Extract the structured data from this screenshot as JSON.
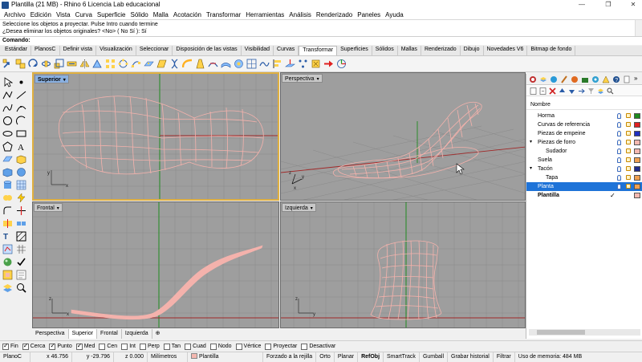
{
  "window": {
    "title": "Plantilla (21 MB) - Rhino 6 Licencia Lab educacional",
    "controls": [
      "—",
      "❐",
      "✕"
    ]
  },
  "menu": [
    "Archivo",
    "Edición",
    "Vista",
    "Curva",
    "Superficie",
    "Sólido",
    "Malla",
    "Acotación",
    "Transformar",
    "Herramientas",
    "Análisis",
    "Renderizado",
    "Paneles",
    "Ayuda"
  ],
  "command_history": [
    "Seleccione los objetos a proyectar. Pulse Intro cuando termine",
    "¿Desea eliminar los objetos originales? <No> ( No  Sí ): Sí"
  ],
  "command_prompt": "Comando:",
  "toolbar_tabs": [
    "Estándar",
    "PlanosC",
    "Definir vista",
    "Visualización",
    "Seleccionar",
    "Disposición de las vistas",
    "Visibilidad",
    "Curvas",
    "Transformar",
    "Superficies",
    "Sólidos",
    "Mallas",
    "Renderizado",
    "Dibujo",
    "Novedades V6",
    "Bitmap de fondo"
  ],
  "active_toolbar_tab": "Transformar",
  "viewports": {
    "top": {
      "label": "Superior",
      "active": true
    },
    "perspective": {
      "label": "Perspectiva",
      "active": false
    },
    "front": {
      "label": "Frontal",
      "active": false
    },
    "right": {
      "label": "Izquierda",
      "active": false
    }
  },
  "viewport_tabs": [
    "Perspectiva",
    "Superior",
    "Frontal",
    "Izquierda"
  ],
  "active_viewport_tab": "Superior",
  "layers_panel": {
    "header": "Nombre",
    "layers": [
      {
        "name": "Horma",
        "indent": 0,
        "color": "#1f8a1f",
        "twisty": ""
      },
      {
        "name": "Curvas de referencia",
        "indent": 0,
        "color": "#e02020",
        "twisty": ""
      },
      {
        "name": "Piezas de empeine",
        "indent": 0,
        "color": "#2030c0",
        "twisty": ""
      },
      {
        "name": "Piezas de forro",
        "indent": 0,
        "color": "#f4b8b0",
        "twisty": "▾"
      },
      {
        "name": "Sudador",
        "indent": 1,
        "color": "#f4b8b0",
        "twisty": ""
      },
      {
        "name": "Suela",
        "indent": 0,
        "color": "#f0a050",
        "twisty": ""
      },
      {
        "name": "Tacón",
        "indent": 0,
        "color": "#1f2a8a",
        "twisty": "▾"
      },
      {
        "name": "Tapa",
        "indent": 1,
        "color": "#f0a050",
        "twisty": ""
      },
      {
        "name": "Planta",
        "indent": 0,
        "color": "#f0a050",
        "twisty": "",
        "selected": true
      },
      {
        "name": "Plantilla",
        "indent": 0,
        "color": "#f4b8b0",
        "twisty": "",
        "current": true,
        "check": "✓"
      }
    ]
  },
  "osnaps": [
    {
      "label": "Fin",
      "on": true
    },
    {
      "label": "Cerca",
      "on": true
    },
    {
      "label": "Punto",
      "on": true
    },
    {
      "label": "Med",
      "on": true
    },
    {
      "label": "Cen",
      "on": false
    },
    {
      "label": "Int",
      "on": false
    },
    {
      "label": "Perp",
      "on": false
    },
    {
      "label": "Tan",
      "on": false
    },
    {
      "label": "Cuad",
      "on": false
    },
    {
      "label": "Nodo",
      "on": false
    },
    {
      "label": "Vértice",
      "on": false
    },
    {
      "label": "Proyectar",
      "on": false
    },
    {
      "label": "Desactivar",
      "on": false
    }
  ],
  "status": {
    "cplane": "PlanoC",
    "x": "x 46.756",
    "y": "y -29.796",
    "z": "z 0.000",
    "units": "Milímetros",
    "layer": "Plantilla",
    "items": [
      "Forzado a la rejilla",
      "Orto",
      "Planar",
      "RefObj",
      "SmartTrack",
      "Gumball",
      "Grabar historial",
      "Filtrar",
      "Uso de memoria: 484 MB"
    ],
    "bold_item": "RefObj"
  },
  "colors": {
    "viewport_bg": "#9e9e9e",
    "grid": "#8a8a8a",
    "x_axis": "#a02828",
    "y_axis": "#208a20",
    "wire": "#f4b2ac",
    "selected_layer": "#1e73d8"
  }
}
